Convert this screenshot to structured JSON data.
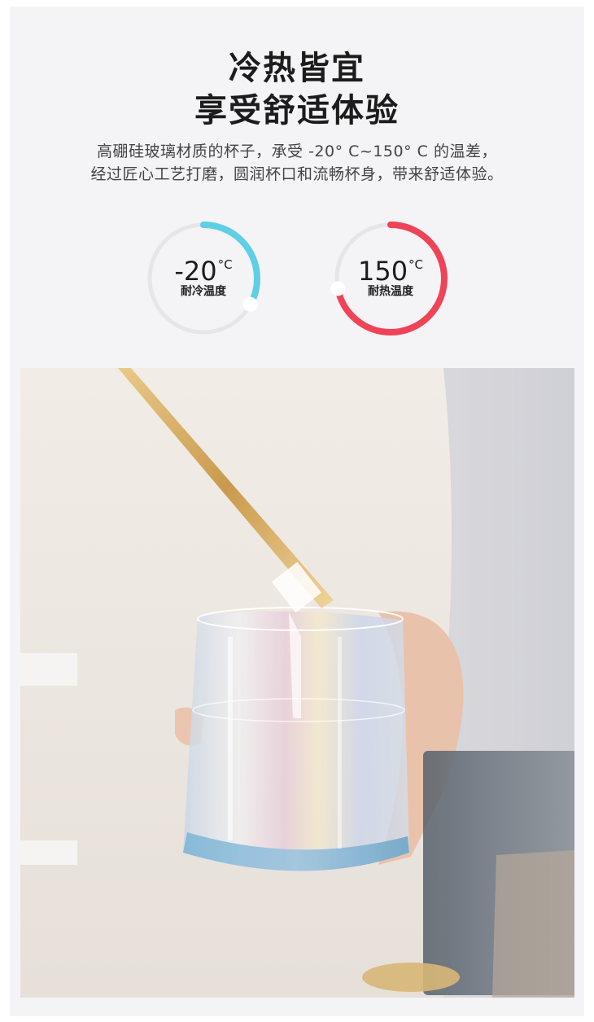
{
  "heading": {
    "line1": "冷热皆宜",
    "line2": "享受舒适体验"
  },
  "description": {
    "line1": "高硼硅玻璃材质的杯子，承受 -20° C~150° C 的温差，",
    "line2": "经过匠心工艺打磨，圆润杯口和流畅杯身，带来舒适体验。"
  },
  "gauges": [
    {
      "value": "-20",
      "unit": "°C",
      "label": "耐冷温度",
      "color": "#5ecfe4",
      "fill_fraction": 0.33
    },
    {
      "value": "150",
      "unit": "°C",
      "label": "耐热温度",
      "color": "#ef4358",
      "fill_fraction": 0.72
    }
  ],
  "colors": {
    "track": "#e6e6e9",
    "background": "#f4f3f6",
    "text": "#1c1c1c"
  }
}
